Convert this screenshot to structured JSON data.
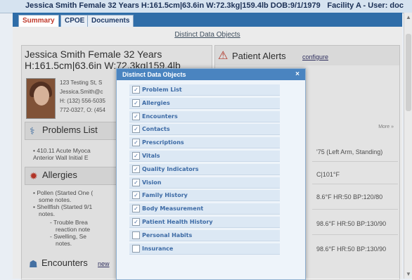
{
  "header": {
    "patient_line": "Jessica Smith  Female  32 Years  H:161.5cm|63.6in  W:72.3kg|159.4lb  DOB:9/1/1979",
    "facility": "Facility A - User: doc"
  },
  "tabs": [
    {
      "label": "Summary",
      "active": true
    },
    {
      "label": "CPOE",
      "active": false
    },
    {
      "label": "Documents",
      "active": false
    }
  ],
  "main": {
    "distinct_link": "Distinct Data Objects"
  },
  "patient": {
    "name_line1": "Jessica Smith  Female  32 Years",
    "name_line2": "H:161.5cm|63.6in  W:72.3kg|159.4lb",
    "address": "123 Testing St, S",
    "email": "Jessica.Smith@c",
    "phone1": "H: (132) 556-5035",
    "phone2": "772-0327, O: (454"
  },
  "problems": {
    "title": "Problems List",
    "lines": [
      "410.11 Acute Myoca",
      "Anterior Wall Initial E"
    ]
  },
  "allergies": {
    "title": "Allergies",
    "lines": [
      "Pollen (Started One (",
      "some notes.",
      "Shellfish (Started 9/1",
      "notes.",
      "Trouble Brea",
      "reaction note",
      "Swelling, Se",
      "notes."
    ]
  },
  "encounters": {
    "title": "Encounters",
    "sub": "new"
  },
  "alerts": {
    "title": "Patient Alerts",
    "configure": "configure"
  },
  "vitals": {
    "more": "More »",
    "lines": [
      "'75 (Left Arm, Standing)",
      "C|101°F",
      "8.6°F HR:50 BP:120/80",
      "98.6°F HR:50 BP:130/90",
      "98.6°F HR:50 BP:130/90"
    ]
  },
  "modal": {
    "title": "Distinct Data Objects",
    "close": "×",
    "items": [
      {
        "label": "Problem List",
        "checked": true
      },
      {
        "label": "Allergies",
        "checked": true
      },
      {
        "label": "Encounters",
        "checked": true
      },
      {
        "label": "Contacts",
        "checked": true
      },
      {
        "label": "Prescriptions",
        "checked": true
      },
      {
        "label": "Vitals",
        "checked": true
      },
      {
        "label": "Quality Indicators",
        "checked": true
      },
      {
        "label": "Vision",
        "checked": true
      },
      {
        "label": "Family History",
        "checked": true
      },
      {
        "label": "Body Measurement",
        "checked": true
      },
      {
        "label": "Patient Health History",
        "checked": true
      },
      {
        "label": "Personal Habits",
        "checked": false
      },
      {
        "label": "Insurance",
        "checked": false
      }
    ]
  }
}
